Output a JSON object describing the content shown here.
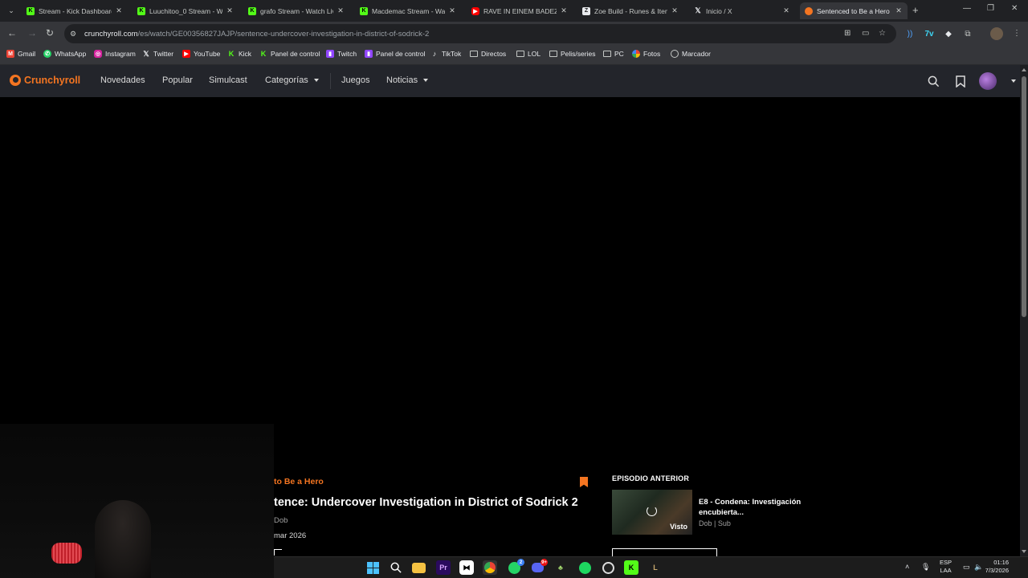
{
  "browser": {
    "tabs": [
      {
        "title": "Stream - Kick Dashboard",
        "icon": "kick-icon"
      },
      {
        "title": "Luuchitoo_0 Stream - Wa",
        "icon": "kick-icon"
      },
      {
        "title": "grafo Stream - Watch Live",
        "icon": "kick-icon"
      },
      {
        "title": "Macdemac Stream - Watc",
        "icon": "kick-icon"
      },
      {
        "title": "RAVE IN EINEM BADEZIM",
        "icon": "youtube-icon"
      },
      {
        "title": "Zoe Build - Runes & Items",
        "icon": "zoe-icon"
      },
      {
        "title": "Inicio / X",
        "icon": "x-icon"
      },
      {
        "title": "Sentenced to Be a Hero S",
        "icon": "crunchyroll-icon",
        "active": true
      }
    ],
    "url_host": "crunchyroll.com",
    "url_path": "/es/watch/GE00356827JAJP/sentence-undercover-investigation-in-district-of-sodrick-2",
    "bookmarks": [
      {
        "label": "Gmail",
        "icon": "gmail-icon"
      },
      {
        "label": "WhatsApp",
        "icon": "whatsapp-icon"
      },
      {
        "label": "Instagram",
        "icon": "instagram-icon"
      },
      {
        "label": "Twitter",
        "icon": "x-icon"
      },
      {
        "label": "YouTube",
        "icon": "youtube-icon"
      },
      {
        "label": "Kick",
        "icon": "kick-icon"
      },
      {
        "label": "Panel de control",
        "icon": "kick-icon"
      },
      {
        "label": "Twitch",
        "icon": "twitch-icon"
      },
      {
        "label": "Panel de control",
        "icon": "twitch-icon"
      },
      {
        "label": "TikTok",
        "icon": "tiktok-icon"
      },
      {
        "label": "Directos",
        "icon": "folder-icon"
      },
      {
        "label": "LOL",
        "icon": "folder-icon"
      },
      {
        "label": "Pelis/series",
        "icon": "folder-icon"
      },
      {
        "label": "PC",
        "icon": "folder-icon"
      },
      {
        "label": "Fotos",
        "icon": "photos-icon"
      },
      {
        "label": "Marcador",
        "icon": "bookmark-manager-icon"
      }
    ]
  },
  "crunchyroll": {
    "logo": "Crunchyroll",
    "nav": {
      "novedades": "Novedades",
      "popular": "Popular",
      "simulcast": "Simulcast",
      "categorias": "Categorías",
      "juegos": "Juegos",
      "noticias": "Noticias"
    },
    "episode": {
      "series_title": "to Be a Hero",
      "title": "tence: Undercover Investigation in District of Sodrick 2",
      "audio": "Dob",
      "release": "mar 2026"
    },
    "previous": {
      "label": "EPISODIO ANTERIOR",
      "title": "E8 - Condena: Investigación encubierta...",
      "meta": "Dob | Sub",
      "watched": "Visto"
    }
  },
  "taskbar": {
    "apps": [
      "windows-start-icon",
      "search-icon",
      "file-explorer-icon",
      "premiere-icon",
      "capcut-icon",
      "chrome-icon",
      "whatsapp-icon",
      "discord-icon",
      "app-icon",
      "spotify-icon",
      "obs-icon",
      "kick-icon",
      "league-icon"
    ],
    "whatsapp_badge": "2",
    "discord_badge": "9+",
    "lang_1": "ESP",
    "lang_2": "LAA",
    "time": "01:16",
    "date": "7/3/2026"
  },
  "colors": {
    "accent": "#f47521",
    "header_bg": "#23252b",
    "kick_green": "#53fc18"
  }
}
